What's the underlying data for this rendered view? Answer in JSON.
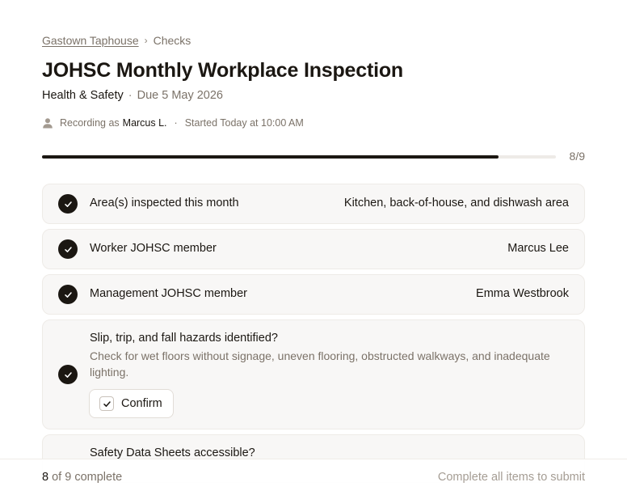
{
  "breadcrumb": {
    "location": "Gastown Taphouse",
    "separator": "›",
    "current": "Checks"
  },
  "header": {
    "title": "JOHSC Monthly Workplace Inspection",
    "category": "Health & Safety",
    "separator": "·",
    "due": "Due 5 May 2026"
  },
  "meta": {
    "recording_prefix": "Recording as",
    "recorder_name": "Marcus L.",
    "separator": "·",
    "started": "Started Today at 10:00 AM",
    "icon": "person-icon"
  },
  "progress": {
    "completed": 8,
    "total": 9,
    "label": "8/9",
    "fraction": 0.889
  },
  "items": [
    {
      "label": "Area(s) inspected this month",
      "answer": "Kitchen, back-of-house, and dishwash area",
      "completed": true
    },
    {
      "label": "Worker JOHSC member",
      "answer": "Marcus Lee",
      "completed": true
    },
    {
      "label": "Management JOHSC member",
      "answer": "Emma Westbrook",
      "completed": true
    },
    {
      "label": "Slip, trip, and fall hazards identified?",
      "description": "Check for wet floors without signage, uneven flooring, obstructed walkways, and inadequate lighting.",
      "confirm_label": "Confirm",
      "confirmed": true,
      "completed": true
    },
    {
      "label": "Safety Data Sheets accessible?"
    }
  ],
  "footer": {
    "count_number": "8",
    "count_suffix": "of 9 complete",
    "submit_hint": "Complete all items to submit"
  },
  "colors": {
    "ink": "#1b1712",
    "muted": "#7b7268",
    "card_bg": "#f8f7f6",
    "track": "#eeebe7"
  }
}
